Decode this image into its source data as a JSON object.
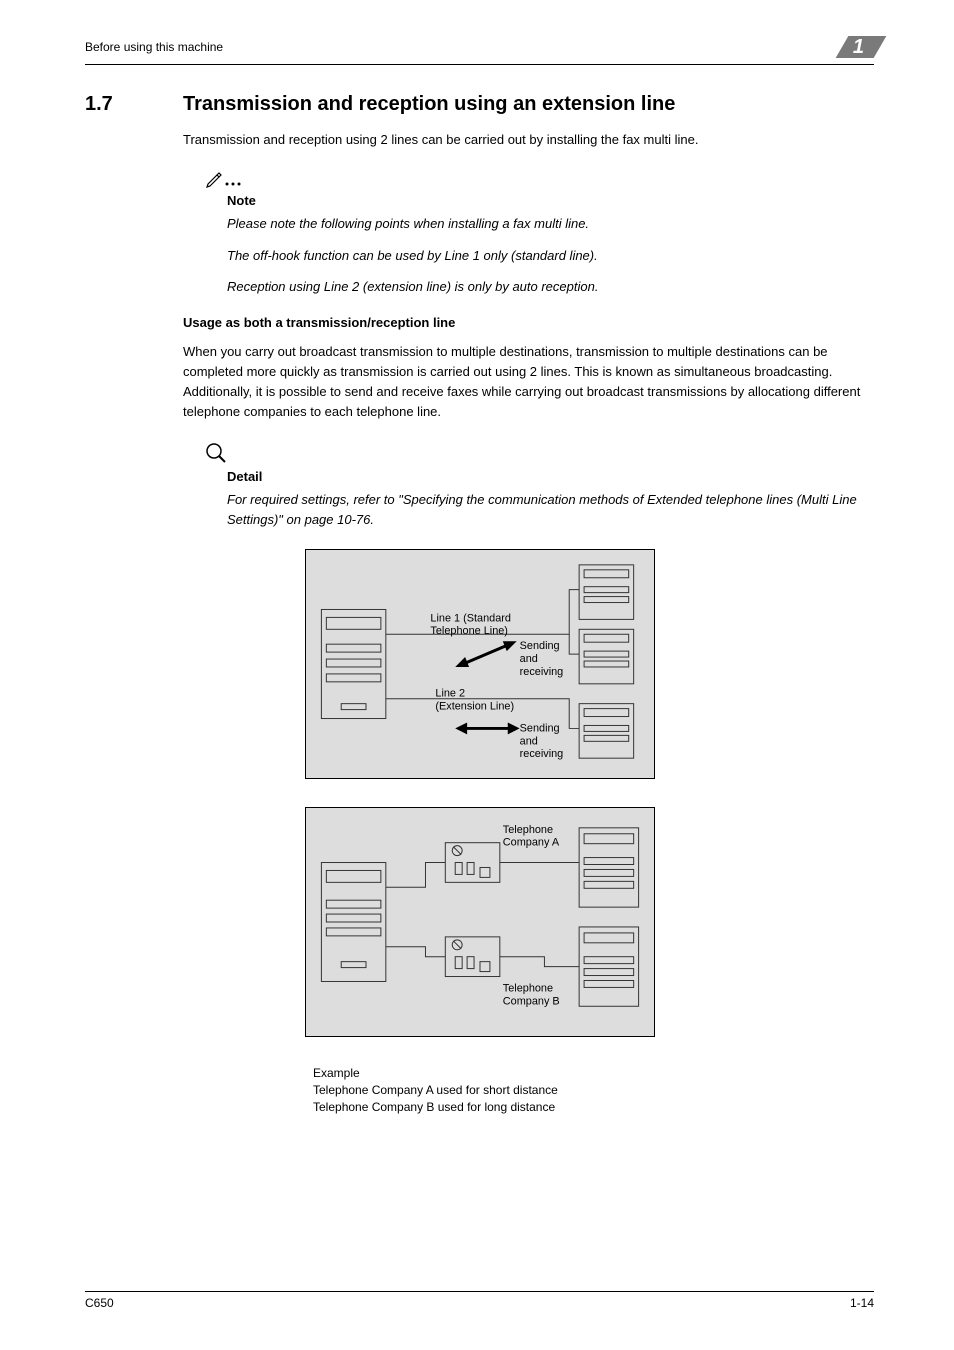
{
  "header": {
    "chapter_label": "Before using this machine",
    "chapter_number": "1"
  },
  "section": {
    "number": "1.7",
    "title": "Transmission and reception using an extension line",
    "intro": "Transmission and reception using 2 lines can be carried out by installing the fax multi line."
  },
  "note": {
    "label": "Note",
    "lines": [
      "Please note the following points when installing a fax multi line.",
      "The off-hook function can be used by Line 1 only (standard line).",
      "Reception using Line 2 (extension line) is only by auto reception."
    ]
  },
  "usage": {
    "heading": "Usage as both a transmission/reception line",
    "para": "When you carry out broadcast transmission to multiple destinations, transmission to multiple destinations can be completed more quickly as transmission is carried out using 2 lines. This is known as simultaneous broadcasting. Additionally, it is possible to send and receive faxes while carrying out broadcast transmissions by allocationg different telephone companies to each telephone line."
  },
  "detail": {
    "label": "Detail",
    "body": "For required settings, refer to \"Specifying the communication methods of Extended telephone lines (Multi Line Settings)\" on page 10-76."
  },
  "diagram1": {
    "line1_label_a": "Line 1 (Standard",
    "line1_label_b": "Telephone Line)",
    "line2_label_a": "Line 2",
    "line2_label_b": "(Extension Line)",
    "sr1_a": "Sending",
    "sr1_b": "and",
    "sr1_c": "receiving",
    "sr2_a": "Sending",
    "sr2_b": "and",
    "sr2_c": "receiving"
  },
  "diagram2": {
    "companyA_a": "Telephone",
    "companyA_b": "Company A",
    "companyB_a": "Telephone",
    "companyB_b": "Company B"
  },
  "example": {
    "title": "Example",
    "l1": "Telephone Company A used for short distance",
    "l2": "Telephone Company B used for long distance"
  },
  "footer": {
    "model": "C650",
    "page": "1-14"
  }
}
